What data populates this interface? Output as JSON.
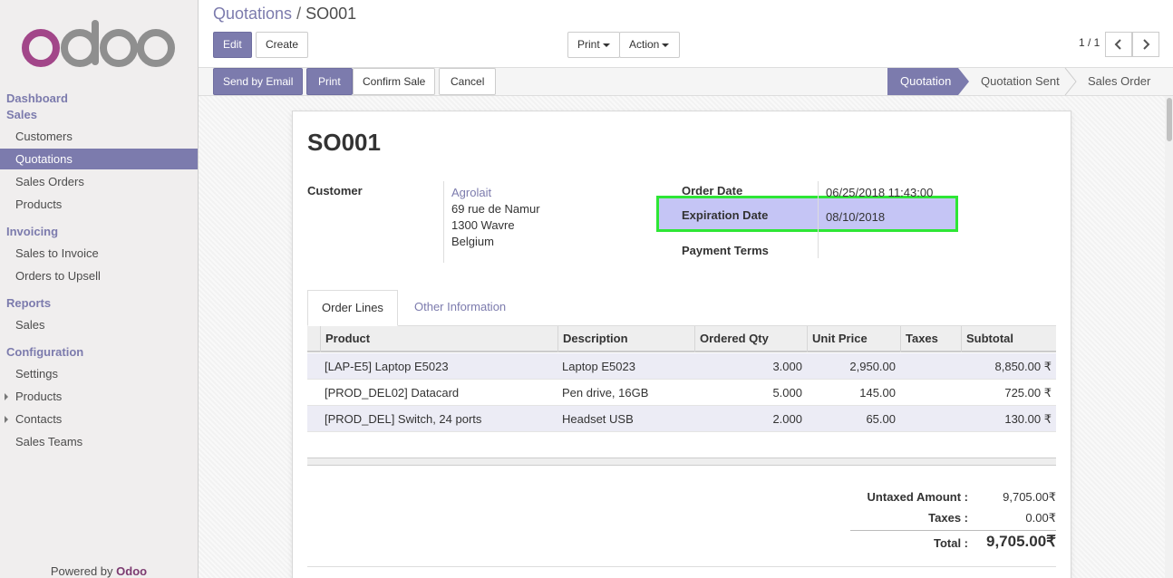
{
  "brand": {
    "logo_text": "odoo",
    "colors": {
      "accent": "#7c7bad",
      "logo_o1": "#a24689",
      "logo_rest": "#8f8f8f",
      "highlight_fill": "#c5c5f5",
      "highlight_border": "#2ee635"
    }
  },
  "sidebar": {
    "sections": [
      {
        "label": "Dashboard"
      },
      {
        "label": "Sales",
        "items": [
          "Customers",
          "Quotations",
          "Sales Orders",
          "Products"
        ]
      },
      {
        "label": "Invoicing",
        "items": [
          "Sales to Invoice",
          "Orders to Upsell"
        ]
      },
      {
        "label": "Reports",
        "items": [
          "Sales"
        ]
      },
      {
        "label": "Configuration",
        "items": [
          "Settings",
          "Products",
          "Contacts",
          "Sales Teams"
        ]
      }
    ],
    "active_item": "Quotations",
    "powered_by": "Powered by",
    "powered_brand": "Odoo"
  },
  "breadcrumb": {
    "parent": "Quotations",
    "separator": "/",
    "current": "SO001"
  },
  "toolbar": {
    "edit": "Edit",
    "create": "Create",
    "print": "Print",
    "action": "Action"
  },
  "pager": {
    "value": "1 / 1"
  },
  "statusbar": {
    "buttons": {
      "send_email": "Send by Email",
      "print": "Print",
      "confirm": "Confirm Sale",
      "cancel": "Cancel"
    },
    "stages": [
      "Quotation",
      "Quotation Sent",
      "Sales Order"
    ],
    "active_stage": "Quotation"
  },
  "form": {
    "title": "SO001",
    "customer_label": "Customer",
    "customer": {
      "name": "Agrolait",
      "street": "69 rue de Namur",
      "city": "1300 Wavre",
      "country": "Belgium"
    },
    "order_date_label": "Order Date",
    "order_date": "06/25/2018 11:43:00",
    "expiration_label": "Expiration Date",
    "expiration_date": "08/10/2018",
    "payment_terms_label": "Payment Terms",
    "payment_terms": ""
  },
  "tabs": [
    "Order Lines",
    "Other Information"
  ],
  "table": {
    "headers": [
      "Product",
      "Description",
      "Ordered Qty",
      "Unit Price",
      "Taxes",
      "Subtotal"
    ],
    "rows": [
      {
        "product": "[LAP-E5] Laptop E5023",
        "description": "Laptop E5023",
        "qty": "3.000",
        "price": "2,950.00",
        "taxes": "",
        "subtotal": "8,850.00 ₹"
      },
      {
        "product": "[PROD_DEL02] Datacard",
        "description": "Pen drive, 16GB",
        "qty": "5.000",
        "price": "145.00",
        "taxes": "",
        "subtotal": "725.00 ₹"
      },
      {
        "product": "[PROD_DEL] Switch, 24 ports",
        "description": "Headset USB",
        "qty": "2.000",
        "price": "65.00",
        "taxes": "",
        "subtotal": "130.00 ₹"
      }
    ]
  },
  "totals": {
    "untaxed_label": "Untaxed Amount :",
    "untaxed": "9,705.00₹",
    "taxes_label": "Taxes :",
    "taxes": "0.00₹",
    "total_label": "Total :",
    "total": "9,705.00₹"
  }
}
